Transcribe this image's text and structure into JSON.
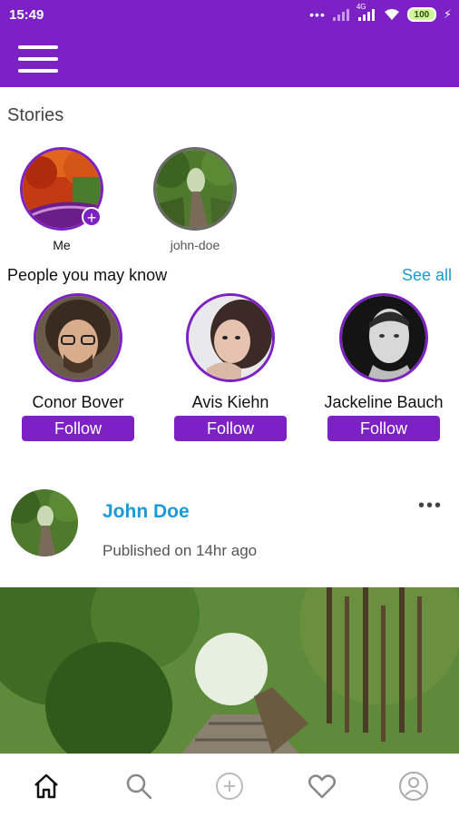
{
  "status_bar": {
    "time": "15:49",
    "network": "4G",
    "battery": "100"
  },
  "app_bar": {
    "menu_icon": "hamburger-menu-icon"
  },
  "stories": {
    "title": "Stories",
    "items": [
      {
        "label": "Me",
        "badge": "+"
      },
      {
        "label": "john-doe"
      }
    ]
  },
  "people_you_may_know": {
    "title": "People you may know",
    "see_all": "See all",
    "people": [
      {
        "name": "Conor Bover",
        "follow": "Follow"
      },
      {
        "name": "Avis Kiehn",
        "follow": "Follow"
      },
      {
        "name": "Jackeline Bauch",
        "follow": "Follow"
      }
    ]
  },
  "post": {
    "author": "John Doe",
    "published": "Published on 14hr ago",
    "more": "•••"
  },
  "bottom_nav": {
    "items": [
      "home-icon",
      "search-icon",
      "add-circle-icon",
      "heart-icon",
      "profile-icon"
    ]
  },
  "colors": {
    "primary": "#7c22c4",
    "link": "#1a9bd6",
    "battery": "#d3f59a"
  }
}
